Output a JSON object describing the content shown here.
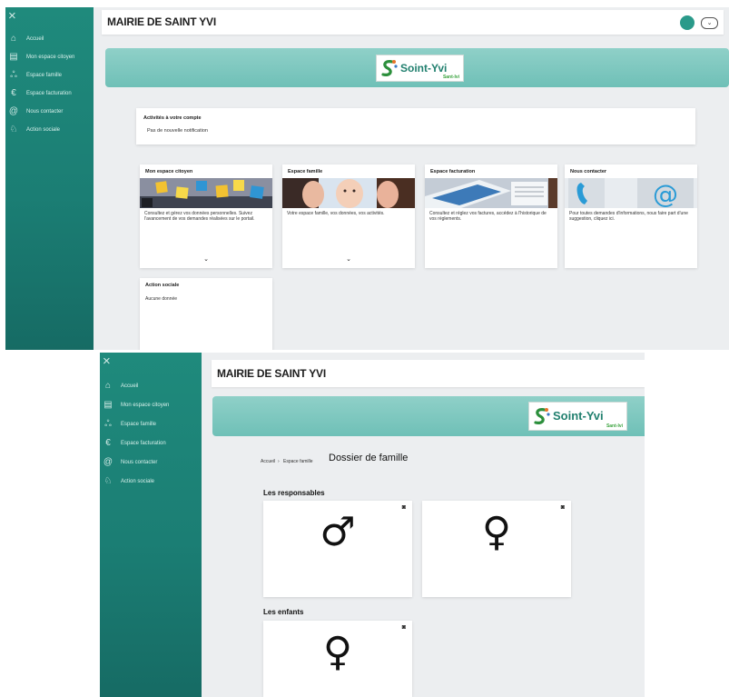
{
  "nav": {
    "close_icon": "×",
    "items": [
      {
        "icon": "home-icon",
        "glyph": "⌂",
        "label": "Accueil"
      },
      {
        "icon": "id-card-icon",
        "glyph": "▤",
        "label": "Mon espace citoyen"
      },
      {
        "icon": "family-icon",
        "glyph": "ஃ",
        "label": "Espace famille"
      },
      {
        "icon": "euro-icon",
        "glyph": "€",
        "label": "Espace facturation"
      },
      {
        "icon": "at-icon",
        "glyph": "@",
        "label": "Nous contacter"
      },
      {
        "icon": "people-icon",
        "glyph": "♘",
        "label": "Action sociale"
      }
    ]
  },
  "header": {
    "title": "MAIRIE DE SAINT YVI",
    "menu_glyph": "⌄"
  },
  "logo": {
    "name": "Soint-Yvi",
    "sub": "Sant-Ivi"
  },
  "dashboard": {
    "notifications": {
      "title": "Activités à votre compte",
      "text": "Pas de nouvelle notification"
    },
    "tiles": [
      {
        "title": "Mon espace citoyen",
        "text": "Consultez et gérez vos données personnelles. Suivez l'avancement de vos demandes réalisées sur le portail.",
        "chevron": "⌄"
      },
      {
        "title": "Espace famille",
        "text": "Votre espace famille, vos données, vos activités.",
        "chevron": "⌄"
      },
      {
        "title": "Espace facturation",
        "text": "Consultez et réglez vos factures, accédez à l'historique de vos règlements.",
        "chevron": ""
      },
      {
        "title": "Nous contacter",
        "text": "Pour toutes demandes d'informations, nous faire part d'une suggestion, cliquez ici.",
        "chevron": ""
      }
    ],
    "social": {
      "title": "Action sociale",
      "text": "Aucune donnée"
    }
  },
  "famille": {
    "breadcrumb": [
      "Accueil",
      "Espace famille"
    ],
    "breadcrumb_sep": "›",
    "page_title": "Dossier de famille",
    "responsables_label": "Les responsables",
    "enfants_label": "Les enfants",
    "camera_glyph": "◙",
    "responsables": [
      {
        "symbol": "♂"
      },
      {
        "symbol": "♀"
      }
    ],
    "enfants": [
      {
        "symbol": "♀"
      }
    ]
  }
}
